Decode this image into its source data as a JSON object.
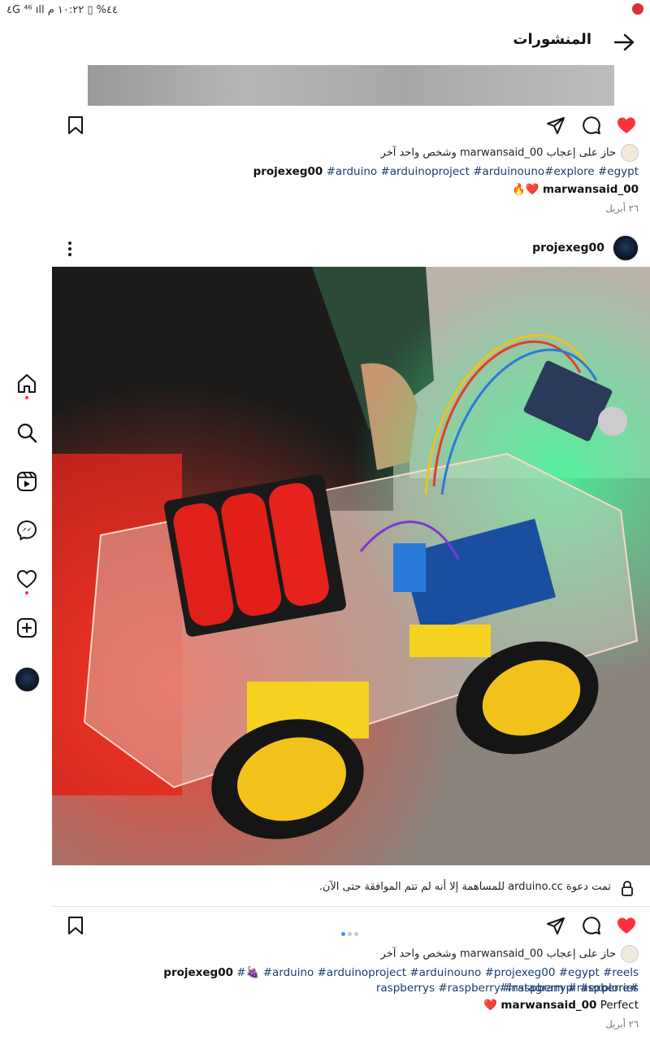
{
  "status_bar": {
    "text": "٤G ⁴⁶ ıll ٤٤% ▯ ١٠:٢٢ م"
  },
  "header": {
    "title": "المنشورات"
  },
  "sidebar": {
    "items": [
      {
        "name": "home"
      },
      {
        "name": "search"
      },
      {
        "name": "reels"
      },
      {
        "name": "messenger"
      },
      {
        "name": "notifications"
      },
      {
        "name": "create"
      },
      {
        "name": "profile"
      }
    ]
  },
  "post1": {
    "liked_by": "حاز على إعجاب marwansaid_00 وشخص واحد آخر",
    "caption_user": "projexeg00",
    "caption_tags": "#arduino #arduinoproject #arduinouno#explore #egypt",
    "comment_user": "marwansaid_00",
    "comment_text": "❤️🔥",
    "date": "٢٦ أبريل"
  },
  "post2": {
    "username": "projexeg00",
    "notice": "تمت دعوة arduino.cc للمساهمة إلا أنه لم تتم الموافقة حتى الآن.",
    "liked_by": "حاز على إعجاب marwansaid_00 وشخص واحد آخر",
    "caption_user": "projexeg00",
    "caption_tags_line1": "#🍇 #arduino #arduinoproject #arduinouno #projexeg00 #egypt #reels #instagram #raspberries",
    "caption_tags_line2": "#raspberrys #raspberry #raspberrypi #explore",
    "comment_user": "marwansaid_00",
    "comment_text": "Perfect ❤️",
    "date": "٢٦ أبريل"
  }
}
